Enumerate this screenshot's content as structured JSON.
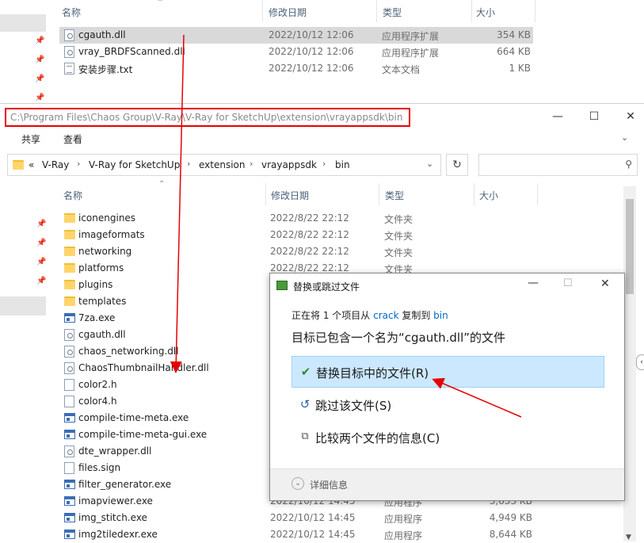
{
  "top_window": {
    "columns": {
      "name": "名称",
      "date": "修改日期",
      "type": "类型",
      "size": "大小"
    },
    "rows": [
      {
        "name": "cgauth.dll",
        "date": "2022/10/12 12:06",
        "type": "应用程序扩展",
        "size": "354 KB",
        "icon": "dll-gear-icon",
        "selected": true
      },
      {
        "name": "vray_BRDFScanned.dll",
        "date": "2022/10/12 12:06",
        "type": "应用程序扩展",
        "size": "664 KB",
        "icon": "dll-gear-icon"
      },
      {
        "name": "安装步骤.txt",
        "date": "2022/10/12 12:06",
        "type": "文本文档",
        "size": "1 KB",
        "icon": "text-file-icon"
      }
    ]
  },
  "second_window": {
    "title_path": "C:\\Program Files\\Chaos Group\\V-Ray\\V-Ray for SketchUp\\extension\\vrayappsdk\\bin",
    "ribbon_tabs": [
      "共享",
      "查看"
    ],
    "breadcrumb": [
      "V-Ray",
      "V-Ray for SketchUp",
      "extension",
      "vrayappsdk",
      "bin"
    ],
    "breadcrumb_prefix": "«",
    "columns": {
      "name": "名称",
      "date": "修改日期",
      "type": "类型",
      "size": "大小"
    },
    "rows": [
      {
        "name": "iconengines",
        "date": "2022/8/22 22:12",
        "type": "文件夹",
        "size": "",
        "icon": "folder"
      },
      {
        "name": "imageformats",
        "date": "2022/8/22 22:12",
        "type": "文件夹",
        "size": "",
        "icon": "folder"
      },
      {
        "name": "networking",
        "date": "2022/8/22 22:12",
        "type": "文件夹",
        "size": "",
        "icon": "folder"
      },
      {
        "name": "platforms",
        "date": "2022/8/22 22:12",
        "type": "文件夹",
        "size": "",
        "icon": "folder"
      },
      {
        "name": "plugins",
        "date": "",
        "type": "",
        "size": "",
        "icon": "folder"
      },
      {
        "name": "templates",
        "date": "",
        "type": "",
        "size": "",
        "icon": "folder"
      },
      {
        "name": "7za.exe",
        "date": "",
        "type": "",
        "size": "",
        "icon": "exe"
      },
      {
        "name": "cgauth.dll",
        "date": "",
        "type": "",
        "size": "",
        "icon": "dll"
      },
      {
        "name": "chaos_networking.dll",
        "date": "",
        "type": "",
        "size": "",
        "icon": "dll"
      },
      {
        "name": "ChaosThumbnailHandler.dll",
        "date": "",
        "type": "",
        "size": "",
        "icon": "dll"
      },
      {
        "name": "color2.h",
        "date": "",
        "type": "",
        "size": "",
        "icon": "file"
      },
      {
        "name": "color4.h",
        "date": "",
        "type": "",
        "size": "",
        "icon": "file"
      },
      {
        "name": "compile-time-meta.exe",
        "date": "",
        "type": "",
        "size": "",
        "icon": "exe"
      },
      {
        "name": "compile-time-meta-gui.exe",
        "date": "",
        "type": "",
        "size": "",
        "icon": "exe"
      },
      {
        "name": "dte_wrapper.dll",
        "date": "",
        "type": "",
        "size": "",
        "icon": "dll"
      },
      {
        "name": "files.sign",
        "date": "",
        "type": "",
        "size": "",
        "icon": "file"
      },
      {
        "name": "filter_generator.exe",
        "date": "",
        "type": "",
        "size": "",
        "icon": "exe"
      },
      {
        "name": "imapviewer.exe",
        "date": "2022/10/12 14:45",
        "type": "应用程序",
        "size": "3,633 KB",
        "icon": "exe"
      },
      {
        "name": "img_stitch.exe",
        "date": "2022/10/12 14:45",
        "type": "应用程序",
        "size": "4,949 KB",
        "icon": "exe"
      },
      {
        "name": "img2tiledexr.exe",
        "date": "2022/10/12 14:45",
        "type": "应用程序",
        "size": "8,644 KB",
        "icon": "exe"
      }
    ]
  },
  "dialog": {
    "title": "替换或跳过文件",
    "info_prefix": "正在将 1 个项目从 ",
    "info_from": "crack",
    "info_mid": " 复制到 ",
    "info_to": "bin",
    "headline": "目标已包含一个名为“cgauth.dll”的文件",
    "options": [
      {
        "label": "替换目标中的文件(R)",
        "icon": "check-icon",
        "selected": true
      },
      {
        "label": "跳过该文件(S)",
        "icon": "skip-icon"
      },
      {
        "label": "比较两个文件的信息(C)",
        "icon": "compare-icon"
      }
    ],
    "details": "详细信息",
    "link_color": "#0066cc"
  },
  "annotation_color": "#e60000"
}
